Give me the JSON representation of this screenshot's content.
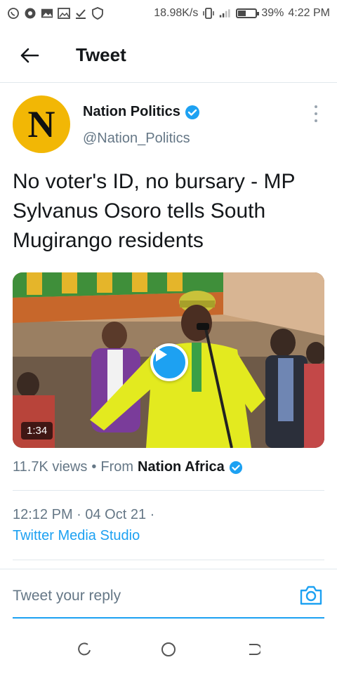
{
  "status_bar": {
    "speed": "18.98K/s",
    "battery": "39%",
    "battery_level": 0.39,
    "time": "4:22 PM",
    "icons": [
      "whatsapp-icon",
      "chrome-icon",
      "gallery-icon",
      "image-icon",
      "download-icon",
      "shield-icon",
      "vibrate-icon",
      "signal-icon",
      "battery-icon"
    ]
  },
  "header": {
    "title": "Tweet"
  },
  "tweet": {
    "author_name": "Nation Politics",
    "author_handle": "@Nation_Politics",
    "avatar_letter": "N",
    "text": "No voter's ID, no bursary - MP Sylvanus Osoro tells South Mugirango residents",
    "video_duration": "1:34",
    "views": "11.7K views",
    "separator": "•",
    "from_label": "From",
    "source": "Nation Africa",
    "timestamp": "12:12 PM · 04 Oct 21 ·",
    "client": "Twitter Media Studio"
  },
  "reply": {
    "placeholder": "Tweet your reply"
  },
  "colors": {
    "accent": "#1da1f2",
    "avatar_bg": "#f2b705",
    "text_secondary": "#657786"
  }
}
